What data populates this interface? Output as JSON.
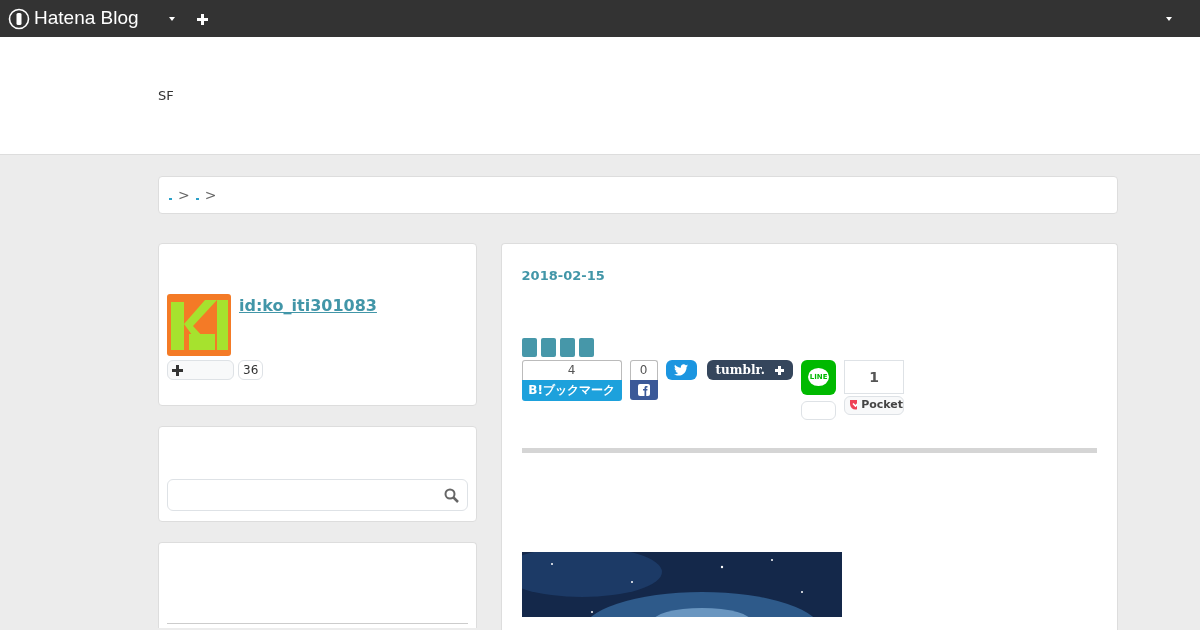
{
  "topbar": {
    "brand": "Hatena Blog"
  },
  "header": {
    "blog_title": "SF"
  },
  "breadcrumb": {
    "separators": [
      ">",
      ">"
    ]
  },
  "profile": {
    "user_id": "id:ko_iti301083",
    "follower_count": "36"
  },
  "entry": {
    "date": "2018-02-15",
    "categories": [
      {
        "kind": "tag"
      },
      {
        "kind": "tag"
      },
      {
        "kind": "tag"
      },
      {
        "kind": "tag"
      }
    ],
    "share": {
      "hatena_count": "4",
      "hatena_label": "B!ブックマーク",
      "facebook_count": "0",
      "tumblr_label": "tumblr.",
      "line_label": "LINE",
      "pocket_count": "1",
      "pocket_label": "Pocket"
    }
  }
}
